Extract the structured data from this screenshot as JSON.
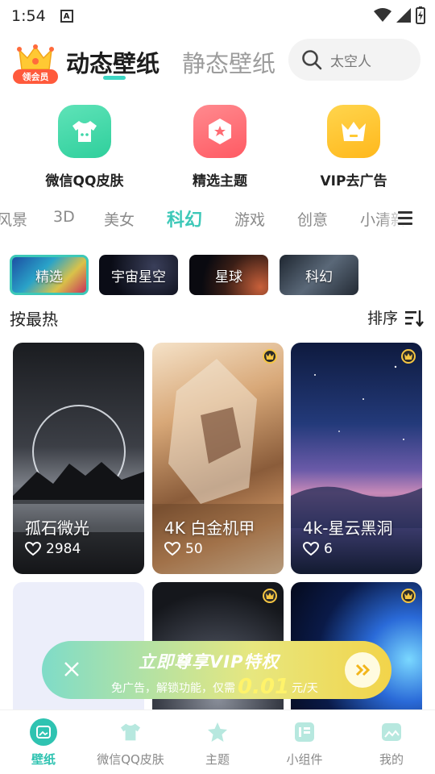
{
  "status": {
    "time": "1:54",
    "notif_glyph": "A"
  },
  "header": {
    "vip_badge": "领会员",
    "tab_dynamic": "动态壁纸",
    "tab_static": "静态壁纸",
    "search_placeholder": "太空人"
  },
  "quick_actions": [
    {
      "label": "微信QQ皮肤",
      "icon": "tshirt-icon",
      "color": "#3dd6a8"
    },
    {
      "label": "精选主题",
      "icon": "hexagon-star-icon",
      "color": "#ff6b73"
    },
    {
      "label": "VIP去广告",
      "icon": "crown-icon",
      "color": "#ffc933"
    }
  ],
  "categories": [
    "风景",
    "3D",
    "美女",
    "科幻",
    "游戏",
    "创意",
    "小清新"
  ],
  "active_category": "科幻",
  "subtopics": [
    "精选",
    "宇宙星空",
    "星球",
    "科幻"
  ],
  "list": {
    "sort_title": "按最热",
    "sort_label": "排序"
  },
  "cards": [
    {
      "title": "孤石微光",
      "likes": "2984",
      "vip": false
    },
    {
      "title": "4K 白金机甲",
      "likes": "50",
      "vip": true
    },
    {
      "title": "4k-星云黑洞",
      "likes": "6",
      "vip": true
    },
    {
      "title": "",
      "likes": "",
      "vip": false
    },
    {
      "title": "",
      "likes": "",
      "vip": true
    },
    {
      "title": "",
      "likes": "",
      "vip": true
    }
  ],
  "banner": {
    "title": "立即尊享VIP特权",
    "subtitle": "免广告，解锁功能，仅需",
    "price": "0.01",
    "unit": "元/天"
  },
  "bottom_nav": [
    {
      "label": "壁纸",
      "active": true
    },
    {
      "label": "微信QQ皮肤",
      "active": false
    },
    {
      "label": "主题",
      "active": false
    },
    {
      "label": "小组件",
      "active": false
    },
    {
      "label": "我的",
      "active": false
    }
  ],
  "colors": {
    "accent": "#3dc8b8",
    "vip_pill": "#ff5a3c",
    "banner_start": "#7fdcc8",
    "banner_end": "#f2d44a"
  }
}
